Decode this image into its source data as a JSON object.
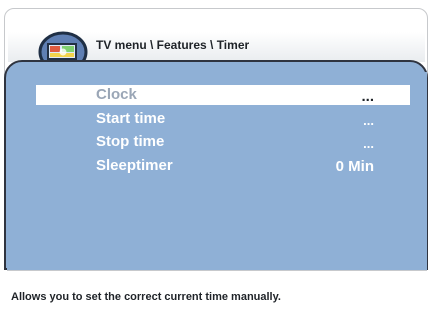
{
  "header": {
    "breadcrumb": "TV menu \\ Features \\ Timer",
    "logo_icon": "tv-menu-logo-icon"
  },
  "menu": {
    "items": [
      {
        "label": "Clock",
        "value": "...",
        "selected": true
      },
      {
        "label": "Start time",
        "value": "..."
      },
      {
        "label": "Stop time",
        "value": "..."
      },
      {
        "label": "Sleeptimer",
        "value": "0 Min"
      }
    ]
  },
  "footer": {
    "help_text": "Allows you to set the correct current time manually."
  },
  "colors": {
    "menu_bg": "#8fb0d6",
    "frame": "#2f3440",
    "highlight": "#ffffff"
  }
}
